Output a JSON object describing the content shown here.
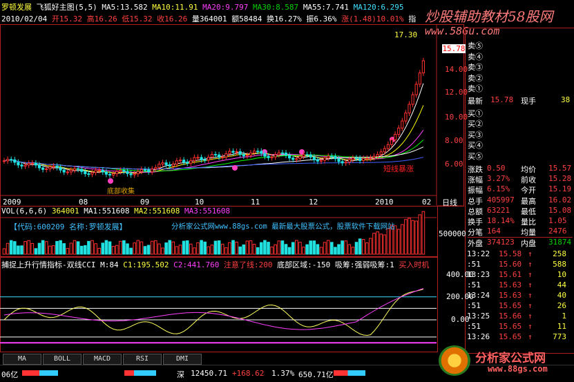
{
  "header": {
    "stock_name": "罗顿发展",
    "indicator_main": "飞狐好主图(5,5)",
    "ma5": "MA5:13.582",
    "ma10": "MA10:11.91",
    "ma20": "MA20:9.797",
    "ma30": "MA30:8.587",
    "ma55": "MA55:7.741",
    "ma_extra": "MA120:6.295",
    "date": "2010/02/04",
    "open": "开15.32",
    "high": "高16.26",
    "low": "低15.32",
    "close": "收16.26",
    "vol": "量364001",
    "amount": "额58484",
    "turnover": "换16.27%",
    "amplitude": "振6.36%",
    "change": "涨(1.48)10.01%",
    "zhi": "指"
  },
  "watermark": {
    "top_right": "炒股辅助教材58股网",
    "url": "www.58Gu.com",
    "bottom_right_brand": "分析家公式网",
    "bottom_right_url": "www.88gs.com"
  },
  "price_chart": {
    "high_label": "17.30",
    "current_price": "15.78",
    "axis": [
      "14.00",
      "12.00",
      "10.00",
      "8.00",
      "6.00"
    ],
    "x_labels": [
      "2009",
      "08",
      "09",
      "10",
      "11",
      "12",
      "2010",
      "02"
    ],
    "day_button": "日线",
    "annotations": [
      "短线暴涨",
      "底部收集"
    ]
  },
  "vol_chart": {
    "title": "VOL(6,6,6)",
    "value": "364001",
    "ma1": "MA1:551608",
    "ma2": "MA2:551608",
    "ma3": "MA3:551608",
    "banner": "【代码:600209 名称:罗顿发展】",
    "banner2": "分析家公式网www.88gs.com 最新最大股票公式，股票软件下载网站",
    "axis": "500000"
  },
  "cci_chart": {
    "title": "捕捉上升行情指标-双线CCI",
    "m": "M:84",
    "c1": "C1:195.502",
    "c2": "C2:441.760",
    "warn": "注意了线:200",
    "bottom": "底部区域:-150",
    "absorb": "吸筹:强弱吸筹:1",
    "buy": "买入时机",
    "axis": [
      "400.00",
      "200.00",
      "0.00"
    ]
  },
  "tabs": [
    "MA",
    "BOLL",
    "MACD",
    "RSI",
    "DMI"
  ],
  "status_bar": {
    "left": "06亿",
    "market": "深",
    "index": "12450.71",
    "change": "+168.62",
    "pct": "1.37%",
    "amount": "650.71亿"
  },
  "quote_panel": {
    "sell": [
      {
        "label": "卖⑤",
        "price": "",
        "vol": ""
      },
      {
        "label": "卖④",
        "price": "",
        "vol": ""
      },
      {
        "label": "卖③",
        "price": "",
        "vol": ""
      },
      {
        "label": "卖②",
        "price": "",
        "vol": ""
      },
      {
        "label": "卖①",
        "price": "",
        "vol": ""
      }
    ],
    "latest_label": "最新",
    "latest": "15.78",
    "hand_label": "现手",
    "hand": "38",
    "buy": [
      {
        "label": "买①",
        "price": "",
        "vol": ""
      },
      {
        "label": "买②",
        "price": "",
        "vol": ""
      },
      {
        "label": "买③",
        "price": "",
        "vol": ""
      },
      {
        "label": "买④",
        "price": "",
        "vol": ""
      },
      {
        "label": "买⑤",
        "price": "",
        "vol": ""
      }
    ],
    "stats": [
      {
        "k1": "涨跌",
        "v1": "0.50",
        "k2": "均价",
        "v2": "15.57"
      },
      {
        "k1": "涨幅",
        "v1": "3.27%",
        "k2": "前收",
        "v2": "15.28"
      },
      {
        "k1": "振幅",
        "v1": "6.15%",
        "k2": "今开",
        "v2": "15.19"
      },
      {
        "k1": "总手",
        "v1": "405997",
        "k2": "最高",
        "v2": "16.02"
      },
      {
        "k1": "总额",
        "v1": "63221",
        "k2": "最低",
        "v2": "15.08"
      },
      {
        "k1": "换手",
        "v1": "18.14%",
        "k2": "量比",
        "v2": "1.05"
      },
      {
        "k1": "分笔",
        "v1": "164",
        "k2": "均量",
        "v2": "2476"
      }
    ],
    "outer_label": "外盘",
    "outer": "374123",
    "inner_label": "内盘",
    "inner": "31874",
    "ticks": [
      {
        "t": "13:22",
        "p": "15.58",
        "v": "258"
      },
      {
        "t": ":51",
        "p": "15.60",
        "v": "588"
      },
      {
        "t": "13:23",
        "p": "15.61",
        "v": "10"
      },
      {
        "t": ":51",
        "p": "15.63",
        "v": "44"
      },
      {
        "t": "13:24",
        "p": "15.63",
        "v": "40"
      },
      {
        "t": ":51",
        "p": "15.65",
        "v": "26"
      },
      {
        "t": "13:25",
        "p": "15.66",
        "v": "1"
      },
      {
        "t": ":51",
        "p": "15.65",
        "v": "11"
      },
      {
        "t": "13:26",
        "p": "15.65",
        "v": "773"
      }
    ]
  }
}
